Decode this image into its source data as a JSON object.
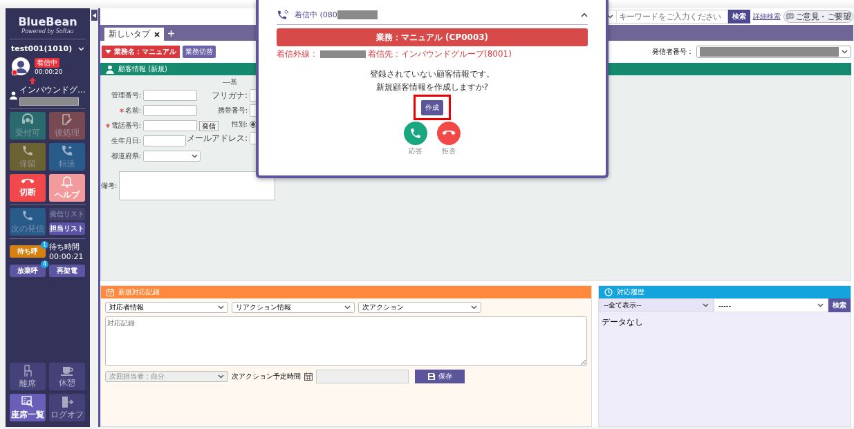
{
  "sidebar": {
    "logo": {
      "title": "BlueBean",
      "subtitle": "Powered by Softau"
    },
    "user": {
      "name": "test001(1010)"
    },
    "status": {
      "badge": "着信中",
      "time": "00:00:20"
    },
    "group": {
      "name": "インバウンドグ…"
    },
    "buttons": [
      {
        "label": "受付可",
        "color": "#2b6a6c",
        "disabled": true
      },
      {
        "label": "後処理",
        "color": "#774a52",
        "disabled": true
      },
      {
        "label": "保留",
        "color": "#6b6234",
        "disabled": true
      },
      {
        "label": "転送",
        "color": "#285a8a",
        "disabled": true
      },
      {
        "label": "切断",
        "color": "#f2474b",
        "disabled": false
      },
      {
        "label": "ヘルプ",
        "color": "#f39a9c",
        "disabled": false
      }
    ],
    "next_call": {
      "label": "次の発信",
      "disabled": true
    },
    "lists": [
      {
        "label": "発信リスト",
        "disabled": true
      },
      {
        "label": "担当リスト",
        "disabled": false
      }
    ],
    "queues": [
      {
        "label": "待ち呼",
        "count": "1",
        "color": "#d6800d"
      },
      {
        "label": "放棄呼",
        "count": "4",
        "color": "#5c55a2"
      }
    ],
    "wait": {
      "label": "待ち時間",
      "time": "00:00:21"
    },
    "redial": "再架電",
    "bottom_buttons": [
      {
        "label": "離席",
        "disabled": true
      },
      {
        "label": "休憩",
        "disabled": true
      },
      {
        "label": "座席一覧",
        "disabled": false
      },
      {
        "label": "ログオフ",
        "disabled": true
      }
    ]
  },
  "top_bar": {
    "search_placeholder": "キーワードをご入力ください",
    "search_button": "検索",
    "advanced_link": "詳細検索",
    "feedback_button": "ご意見・ご要望"
  },
  "tabs": [
    {
      "label": "新しいタブ",
      "selected": true
    }
  ],
  "toolbar": {
    "task_button": "業務名：マニュアル",
    "switch_button": "業務切替",
    "caller_label": "発信者番号："
  },
  "customer": {
    "title": "顧客情報 (新規)",
    "section_heading": "---基",
    "left_fields": [
      {
        "label": "管理番号:",
        "required": false,
        "kind": "text"
      },
      {
        "label": "名前:",
        "required": true,
        "kind": "text"
      },
      {
        "label": "電話番号:",
        "required": true,
        "kind": "phone",
        "button": "発信"
      },
      {
        "label": "生年月日:",
        "required": false,
        "kind": "short"
      },
      {
        "label": "都道府県:",
        "required": false,
        "kind": "select"
      }
    ],
    "right_fields": [
      {
        "label": "フリガナ:",
        "kind": "text"
      },
      {
        "label": "携帯番号:",
        "kind": "text"
      },
      {
        "label": "性別:",
        "kind": "radio",
        "checked": true
      },
      {
        "label": "メールアドレス:",
        "kind": "text"
      }
    ],
    "notes_label": "備考:"
  },
  "record": {
    "title": "新規対応記録",
    "selects": [
      "対応者情報",
      "リアクション情報",
      "次アクション"
    ],
    "notes_placeholder": "対応記録",
    "assignee": "次回担当者：自分",
    "schedule_label": "次アクション予定時間",
    "save_button": "保存"
  },
  "history": {
    "title": "対応履歴",
    "filter": "--全て表示--",
    "filter2": "-----",
    "search_button": "検索",
    "empty": "データなし"
  },
  "incoming_call": {
    "title": "着信中 (080",
    "expanded": true,
    "task": "業務：マニュアル (CP0003)",
    "line_label": "着信外線：",
    "dest": "着信先：インバウンドグループ(8001)",
    "message": [
      "登録されていない顧客情報です。",
      "新規顧客情報を作成しますか?"
    ],
    "create_button": "作成",
    "answer": "応答",
    "reject": "拒否"
  }
}
